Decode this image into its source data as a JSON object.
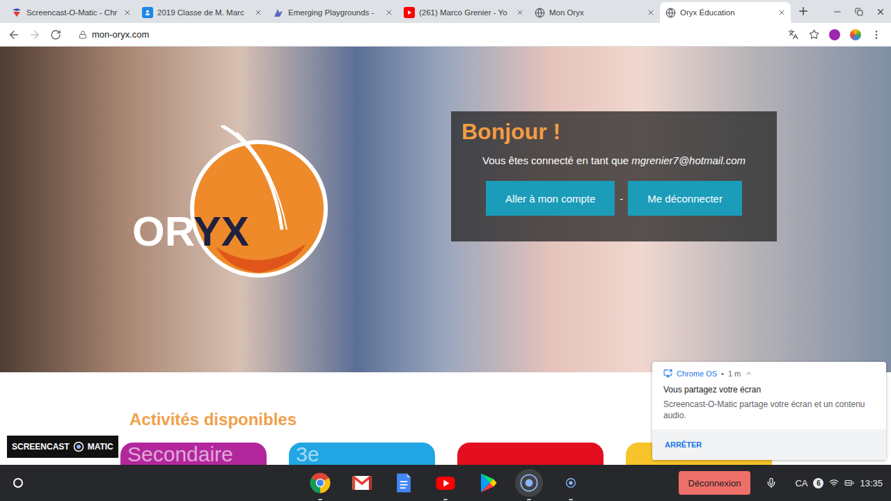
{
  "browser": {
    "tabs": [
      {
        "title": "Screencast-O-Matic - Chr",
        "kind": "screencast",
        "selected": false
      },
      {
        "title": "2019 Classe de M. Marc",
        "kind": "classroom",
        "selected": false
      },
      {
        "title": "Emerging Playgrounds -",
        "kind": "emerging",
        "selected": false
      },
      {
        "title": "(261) Marco Grenier - Yo",
        "kind": "youtube",
        "selected": false
      },
      {
        "title": "Mon Oryx",
        "kind": "globe",
        "selected": false
      },
      {
        "title": "Oryx Éducation",
        "kind": "globe",
        "selected": true
      }
    ],
    "address": "mon-oryx.com"
  },
  "page": {
    "logo": {
      "light": "OR",
      "dark": "YX"
    },
    "welcome": {
      "title": "Bonjour !",
      "message": "Vous êtes connecté en tant que",
      "email": "mgrenier7@hotmail.com",
      "buttons": [
        "Aller à mon compte",
        "Me déconnecter"
      ],
      "separator": "-"
    },
    "activities": {
      "title": "Activités disponibles",
      "cards": [
        {
          "label": "Secondaire",
          "color": "#b3279d"
        },
        {
          "label": "3e",
          "color": "#21a5e3"
        },
        {
          "color": "#e30f20"
        },
        {
          "color": "#f7c52b"
        }
      ]
    }
  },
  "watermark": {
    "left": "SCREENCAST",
    "right": "MATIC"
  },
  "notification": {
    "source": "Chrome OS",
    "separator": "•",
    "time": "1 m",
    "title": "Vous partagez votre écran",
    "body": "Screencast-O-Matic partage votre écran et un contenu audio.",
    "action": "ARRÊTER"
  },
  "shelf": {
    "apps": [
      {
        "kind": "chrome",
        "running": true,
        "selected": false
      },
      {
        "kind": "gmail",
        "running": false,
        "selected": false
      },
      {
        "kind": "docs",
        "running": false,
        "selected": false
      },
      {
        "kind": "youtube",
        "running": true,
        "selected": false
      },
      {
        "kind": "play",
        "running": false,
        "selected": false
      },
      {
        "kind": "screencast",
        "running": true,
        "selected": true
      },
      {
        "kind": "recorder",
        "running": true,
        "selected": false
      }
    ],
    "signout": "Déconnexion",
    "language": "CA",
    "badge": "6",
    "time": "13:35"
  }
}
